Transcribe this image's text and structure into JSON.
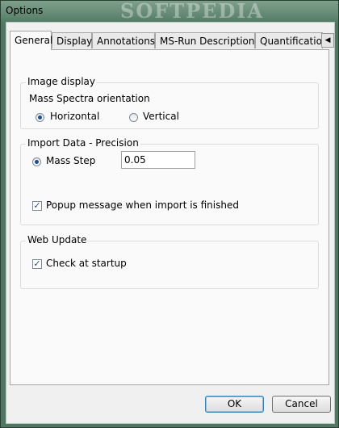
{
  "window": {
    "title": "Options",
    "watermark": "SOFTPEDIA"
  },
  "tabs": [
    {
      "label": "General",
      "active": true
    },
    {
      "label": "Display",
      "active": false
    },
    {
      "label": "Annotations",
      "active": false
    },
    {
      "label": "MS-Run Descriptions",
      "active": false
    },
    {
      "label": "Quantification",
      "active": false
    }
  ],
  "tab_scroll": {
    "left": "◀",
    "right": "▶"
  },
  "image_display": {
    "group_label": "Image display",
    "orientation_label": "Mass Spectra orientation",
    "horizontal_label": "Horizontal",
    "vertical_label": "Vertical",
    "selected": "Horizontal"
  },
  "import_data": {
    "group_label": "Import Data - Precision",
    "mass_step_label": "Mass Step",
    "mass_step_value": "0.05",
    "popup_label": "Popup message when import is finished",
    "popup_checked": true
  },
  "web_update": {
    "group_label": "Web Update",
    "check_startup_label": "Check at startup",
    "check_startup_checked": true
  },
  "buttons": {
    "ok": "OK",
    "cancel": "Cancel"
  },
  "check_glyph": "✓"
}
